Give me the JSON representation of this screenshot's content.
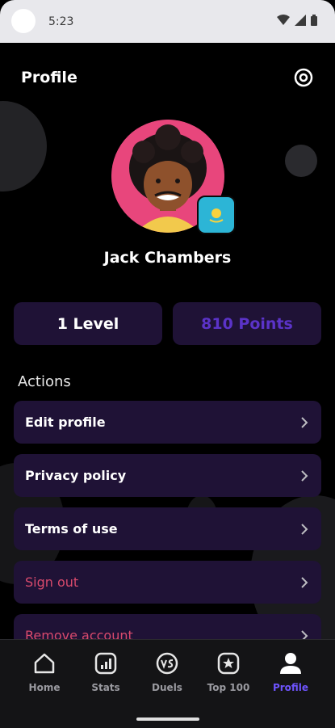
{
  "status_bar": {
    "time": "5:23",
    "icons": [
      "wifi-icon",
      "signal-icon",
      "battery-icon"
    ]
  },
  "header": {
    "title": "Profile",
    "settings_icon": "gear-icon"
  },
  "profile": {
    "name": "Jack Chambers",
    "flag": "kazakhstan-flag"
  },
  "stats": {
    "level_label": "1 Level",
    "points_label": "810 Points"
  },
  "actions": {
    "title": "Actions",
    "items": [
      {
        "label": "Edit profile"
      },
      {
        "label": "Privacy policy"
      },
      {
        "label": "Terms of use"
      },
      {
        "label": "Sign out"
      },
      {
        "label": "Remove account"
      }
    ]
  },
  "nav": {
    "items": [
      {
        "label": "Home",
        "icon": "home-icon"
      },
      {
        "label": "Stats",
        "icon": "stats-icon"
      },
      {
        "label": "Duels",
        "icon": "vs-icon"
      },
      {
        "label": "Top 100",
        "icon": "star-icon"
      },
      {
        "label": "Profile",
        "icon": "user-icon"
      }
    ],
    "active": "Profile"
  },
  "colors": {
    "accent": "#6e54ff",
    "card": "#1f1236",
    "danger": "#d84a6c",
    "points": "#5b33c8"
  }
}
